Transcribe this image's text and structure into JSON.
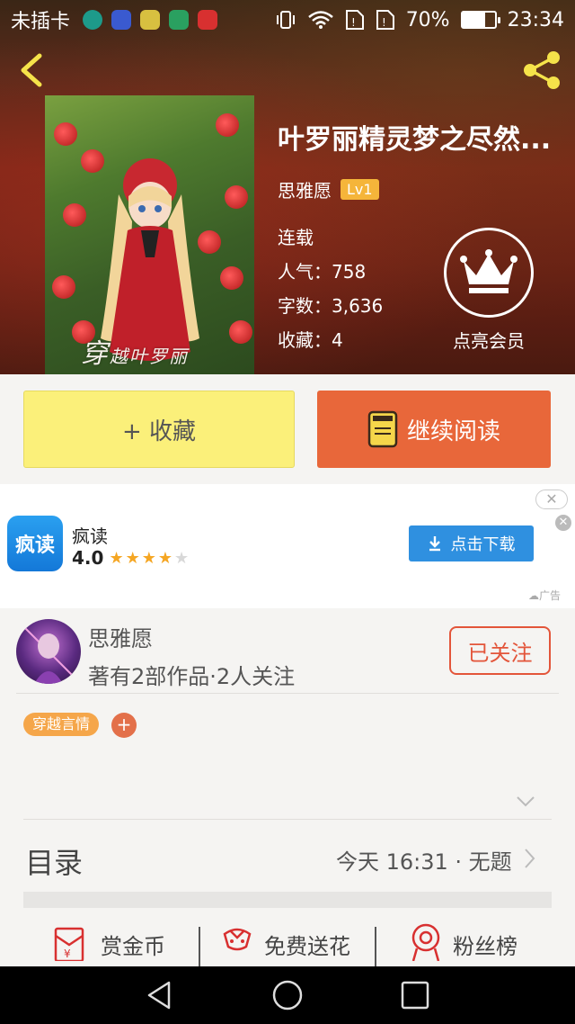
{
  "status_bar": {
    "carrier": "未插卡",
    "battery": "70%",
    "battery_level": 0.7,
    "time": "23:34"
  },
  "book": {
    "title": "叶罗丽精灵梦之尽然...",
    "author": "思雅愿",
    "author_level": "Lv1",
    "status": "连载",
    "popularity": "人气：758",
    "word_count": "字数：3,636",
    "favorites": "收藏：4",
    "cover_text": "穿",
    "cover_subtext": "越叶罗丽"
  },
  "vip": {
    "label": "点亮会员"
  },
  "actions": {
    "collect": "+ 收藏",
    "continue_reading": "继续阅读"
  },
  "ad": {
    "icon_text": "疯读",
    "app_name": "疯读",
    "rating": "4.0",
    "rating_value": 4,
    "rating_max": 5,
    "download_label": "点击下载",
    "ad_label": "广告"
  },
  "author_section": {
    "name": "思雅愿",
    "stats": "著有2部作品·2人关注",
    "follow_button": "已关注",
    "tag": "穿越言情"
  },
  "toc": {
    "label": "目录",
    "latest": "今天 16:31 · 无题"
  },
  "bottom_items": {
    "reward": "赏金币",
    "flowers": "免费送花",
    "fans": "粉丝榜"
  },
  "colors": {
    "collect_bg": "#fbf07a",
    "read_bg": "#e8673a",
    "follow_accent": "#e3553a",
    "tag_bg": "#f5a64a",
    "level_badge": "#f5b53a",
    "download_bg": "#2f90e0"
  },
  "icons": [
    "back-icon",
    "share-icon",
    "crown-icon",
    "book-icon",
    "download-icon",
    "chevron-down-icon",
    "chevron-right-icon",
    "red-envelope-icon",
    "flower-icon",
    "medal-icon",
    "nav-back-icon",
    "nav-home-icon",
    "nav-recent-icon"
  ]
}
